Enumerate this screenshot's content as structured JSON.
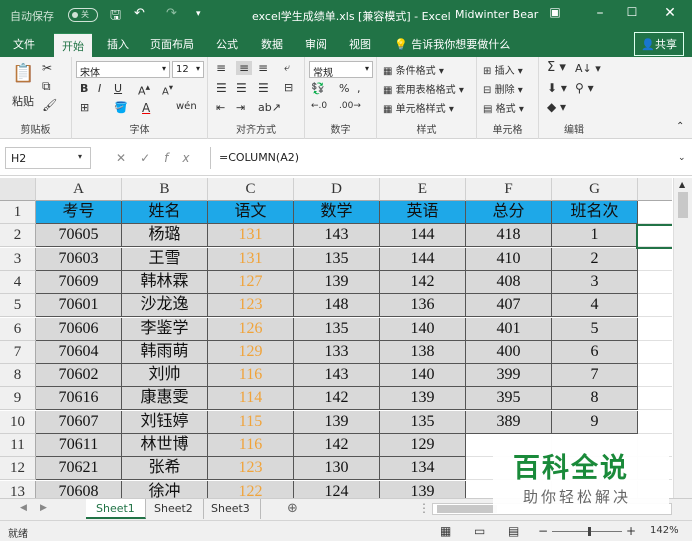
{
  "titlebar": {
    "autosave": "自动保存",
    "toggle": "关",
    "title": "excel学生成绩单.xls [兼容模式] - Excel",
    "user": "Midwinter Bear"
  },
  "tabs": [
    "文件",
    "开始",
    "插入",
    "页面布局",
    "公式",
    "数据",
    "审阅",
    "视图"
  ],
  "tell_me": "告诉我你想要做什么",
  "share": "共享",
  "ribbon": {
    "paste": "粘贴",
    "clipboard": "剪贴板",
    "font_name": "宋体",
    "font_size": "12",
    "font_group": "字体",
    "align_group": "对齐方式",
    "number_format": "常规",
    "number_group": "数字",
    "cond_format": "条件格式",
    "table_format": "套用表格格式",
    "cell_style": "单元格样式",
    "style_group": "样式",
    "insert": "插入",
    "delete": "删除",
    "format": "格式",
    "cells_group": "单元格",
    "edit_group": "编辑"
  },
  "formula_bar": {
    "name_box": "H2",
    "formula": "=COLUMN(A2)"
  },
  "columns": [
    "A",
    "B",
    "C",
    "D",
    "E",
    "F",
    "G"
  ],
  "rows": [
    "1",
    "2",
    "3",
    "4",
    "5",
    "6",
    "7",
    "8",
    "9",
    "10",
    "11",
    "12",
    "13"
  ],
  "table": {
    "headers": [
      "考号",
      "姓名",
      "语文",
      "数学",
      "英语",
      "总分",
      "班名次"
    ],
    "data": [
      [
        "70605",
        "杨璐",
        "131",
        "143",
        "144",
        "418",
        "1"
      ],
      [
        "70603",
        "王雪",
        "131",
        "135",
        "144",
        "410",
        "2"
      ],
      [
        "70609",
        "韩林霖",
        "127",
        "139",
        "142",
        "408",
        "3"
      ],
      [
        "70601",
        "沙龙逸",
        "123",
        "148",
        "136",
        "407",
        "4"
      ],
      [
        "70606",
        "李鉴学",
        "126",
        "135",
        "140",
        "401",
        "5"
      ],
      [
        "70604",
        "韩雨萌",
        "129",
        "133",
        "138",
        "400",
        "6"
      ],
      [
        "70602",
        "刘帅",
        "116",
        "143",
        "140",
        "399",
        "7"
      ],
      [
        "70616",
        "康惠雯",
        "114",
        "142",
        "139",
        "395",
        "8"
      ],
      [
        "70607",
        "刘钰婷",
        "115",
        "139",
        "135",
        "389",
        "9"
      ],
      [
        "70611",
        "林世博",
        "116",
        "142",
        "129",
        "",
        ""
      ],
      [
        "70621",
        "张希",
        "123",
        "130",
        "134",
        "",
        ""
      ],
      [
        "70608",
        "徐冲",
        "122",
        "124",
        "139",
        "",
        ""
      ]
    ]
  },
  "sheets": [
    "Sheet1",
    "Sheet2",
    "Sheet3"
  ],
  "status": {
    "ready": "就绪",
    "zoom": "142%"
  },
  "watermark": {
    "big": "百科全说",
    "small": "助你轻松解决"
  },
  "colors": {
    "accent": "#217346",
    "header_fill": "#1ea8e8",
    "cell_fill": "#d9d9d9",
    "chinese_score": "#f0a33a"
  }
}
